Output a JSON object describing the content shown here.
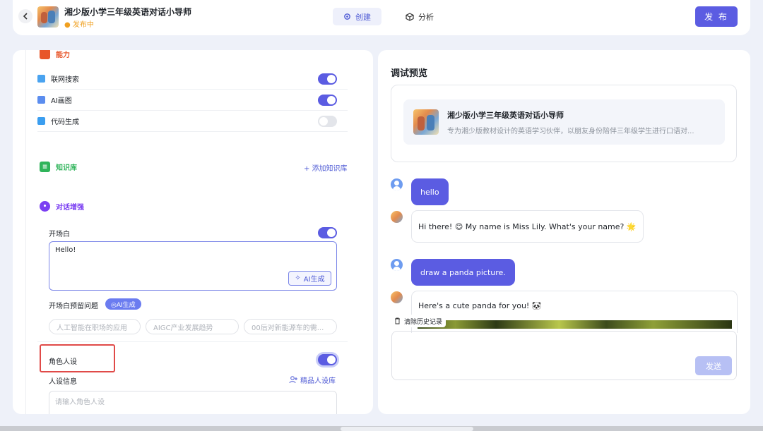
{
  "header": {
    "back_icon": "chevron-left-icon",
    "app_title": "湘少版小学三年级英语对话小导师",
    "app_status": "● 发布中",
    "tabs": [
      {
        "label": "创建",
        "icon": "gear-icon",
        "active": true
      },
      {
        "label": "分析",
        "icon": "cube-icon",
        "active": false
      }
    ],
    "publish_label": "发 布"
  },
  "capabilities": {
    "title": "能力",
    "items": [
      {
        "label": "联网搜索",
        "enabled": true
      },
      {
        "label": "AI画图",
        "enabled": true
      },
      {
        "label": "代码生成",
        "enabled": false
      }
    ]
  },
  "knowledge": {
    "title": "知识库",
    "add_label": "+ 添加知识库"
  },
  "dialog": {
    "title": "对话增强",
    "opening_label": "开场白",
    "opening_enabled": true,
    "opening_text": "Hello!",
    "ai_generate_label": "AI生成",
    "preset_questions_label": "开场白预留问题",
    "preset_ai_badge": "◎AI生成",
    "preset_questions": [
      "人工智能在职场的应用",
      "AIGC产业发展趋势",
      "00后对新能源车的需..."
    ],
    "role_label": "角色人设",
    "role_enabled": true,
    "role_info_label": "人设信息",
    "role_library_label": "精品人设库",
    "role_placeholder": "请输入角色人设"
  },
  "preview": {
    "title": "调试预览",
    "card_title": "湘少版小学三年级英语对话小导师",
    "card_desc": "专为湘少版教材设计的英语学习伙伴，以朋友身份陪伴三年级学生进行口语对...",
    "messages": [
      {
        "role": "user",
        "text": "hello"
      },
      {
        "role": "bot",
        "text": "Hi there! 😊 My name is Miss Lily. What's your name? 🌟"
      },
      {
        "role": "user",
        "text": "draw a panda picture."
      },
      {
        "role": "bot",
        "text": "Here's a cute panda for you! 🐼"
      }
    ],
    "clear_history_label": "清除历史记录",
    "send_label": "发送"
  },
  "colors": {
    "accent": "#5b5ce2",
    "status": "#f0a020",
    "highlight_box": "#e04a48"
  }
}
